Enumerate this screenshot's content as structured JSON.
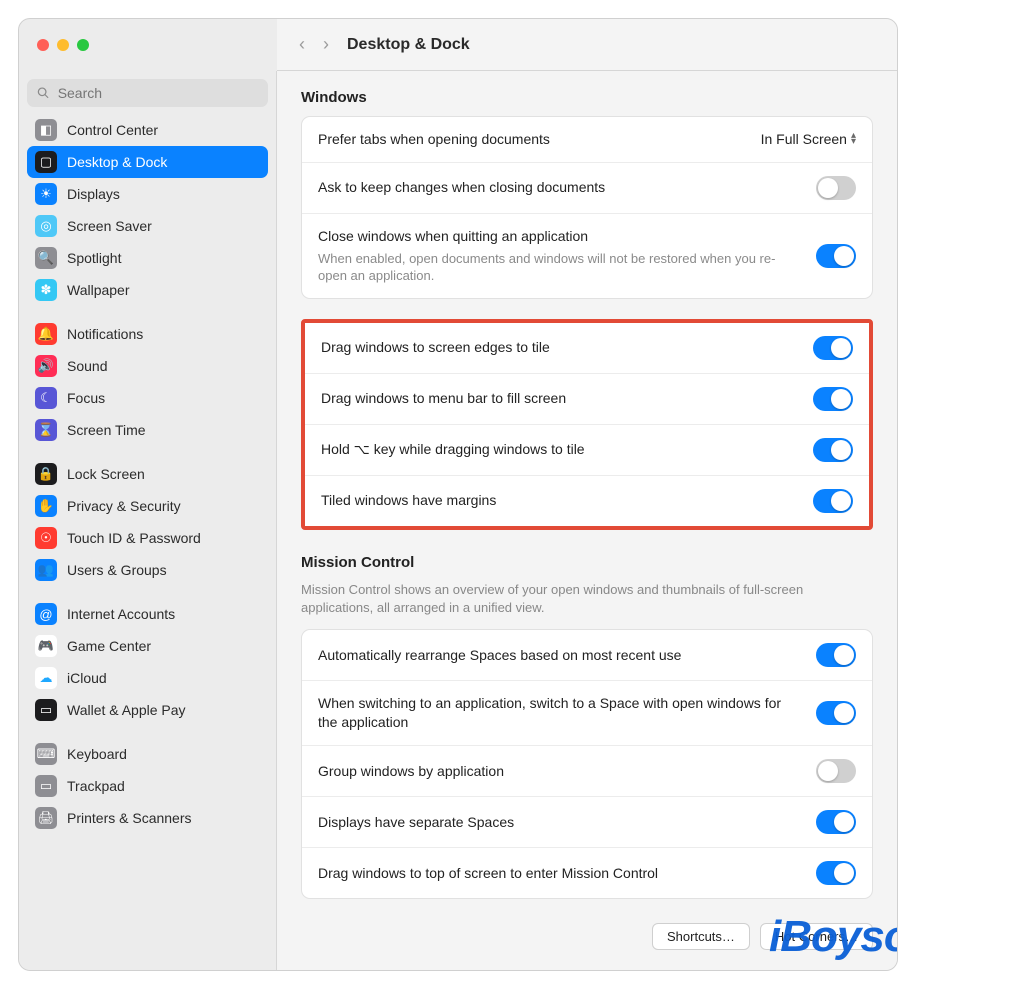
{
  "header": {
    "title": "Desktop & Dock"
  },
  "search": {
    "placeholder": "Search"
  },
  "sidebar": {
    "groups": [
      [
        {
          "label": "Control Center",
          "iconBg": "#8e8e93",
          "glyph": "◧"
        },
        {
          "label": "Desktop & Dock",
          "iconBg": "#1c1c1e",
          "glyph": "▢",
          "selected": true
        },
        {
          "label": "Displays",
          "iconBg": "#0a82ff",
          "glyph": "☀"
        },
        {
          "label": "Screen Saver",
          "iconBg": "#4fc8f7",
          "glyph": "◎"
        },
        {
          "label": "Spotlight",
          "iconBg": "#8e8e93",
          "glyph": "🔍"
        },
        {
          "label": "Wallpaper",
          "iconBg": "#34c8f4",
          "glyph": "✽"
        }
      ],
      [
        {
          "label": "Notifications",
          "iconBg": "#ff3b30",
          "glyph": "🔔"
        },
        {
          "label": "Sound",
          "iconBg": "#ff2d55",
          "glyph": "🔊"
        },
        {
          "label": "Focus",
          "iconBg": "#5856d6",
          "glyph": "☾"
        },
        {
          "label": "Screen Time",
          "iconBg": "#5856d6",
          "glyph": "⌛"
        }
      ],
      [
        {
          "label": "Lock Screen",
          "iconBg": "#1c1c1e",
          "glyph": "🔒"
        },
        {
          "label": "Privacy & Security",
          "iconBg": "#0a82ff",
          "glyph": "✋"
        },
        {
          "label": "Touch ID & Password",
          "iconBg": "#ff3b30",
          "glyph": "☉"
        },
        {
          "label": "Users & Groups",
          "iconBg": "#0a82ff",
          "glyph": "👥"
        }
      ],
      [
        {
          "label": "Internet Accounts",
          "iconBg": "#0a82ff",
          "glyph": "@"
        },
        {
          "label": "Game Center",
          "iconBg": "#ffffff",
          "glyph": "🎮",
          "fg": "#ff3b30"
        },
        {
          "label": "iCloud",
          "iconBg": "#ffffff",
          "glyph": "☁",
          "fg": "#1fa8ff"
        },
        {
          "label": "Wallet & Apple Pay",
          "iconBg": "#1c1c1e",
          "glyph": "▭"
        }
      ],
      [
        {
          "label": "Keyboard",
          "iconBg": "#8e8e93",
          "glyph": "⌨"
        },
        {
          "label": "Trackpad",
          "iconBg": "#8e8e93",
          "glyph": "▭"
        },
        {
          "label": "Printers & Scanners",
          "iconBg": "#8e8e93",
          "glyph": "🖨"
        }
      ]
    ]
  },
  "sections": {
    "windows": {
      "title": "Windows",
      "rows0": {
        "preferTabs": {
          "label": "Prefer tabs when opening documents",
          "value": "In Full Screen"
        },
        "askKeep": {
          "label": "Ask to keep changes when closing documents",
          "on": false
        },
        "closeQuit": {
          "label": "Close windows when quitting an application",
          "sub": "When enabled, open documents and windows will not be restored when you re-open an application.",
          "on": true
        }
      },
      "rowsHighlighted": {
        "dragEdges": {
          "label": "Drag windows to screen edges to tile",
          "on": true
        },
        "dragMenu": {
          "label": "Drag windows to menu bar to fill screen",
          "on": true
        },
        "holdOpt": {
          "label": "Hold ⌥ key while dragging windows to tile",
          "on": true
        },
        "tiledMarg": {
          "label": "Tiled windows have margins",
          "on": true
        }
      }
    },
    "mission": {
      "title": "Mission Control",
      "desc": "Mission Control shows an overview of your open windows and thumbnails of full-screen applications, all arranged in a unified view.",
      "rows": {
        "autoRearr": {
          "label": "Automatically rearrange Spaces based on most recent use",
          "on": true
        },
        "switchSpace": {
          "label": "When switching to an application, switch to a Space with open windows for the application",
          "on": true
        },
        "groupApp": {
          "label": "Group windows by application",
          "on": false
        },
        "sepSpaces": {
          "label": "Displays have separate Spaces",
          "on": true
        },
        "dragTop": {
          "label": "Drag windows to top of screen to enter Mission Control",
          "on": true
        }
      }
    }
  },
  "buttons": {
    "shortcuts": "Shortcuts…",
    "hotCorners": "Hot Corners…"
  },
  "watermark": "iBoysoft"
}
